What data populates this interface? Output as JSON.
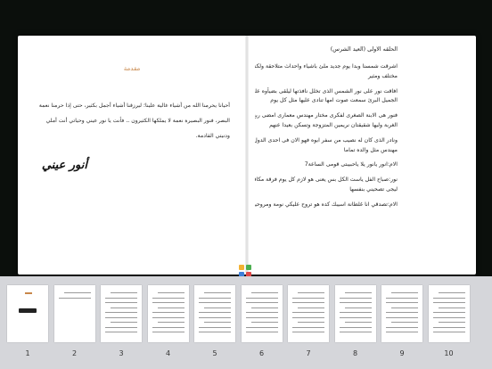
{
  "book": {
    "intro_title": "مقدمة",
    "intro_text": "أحيانا يحرمنا الله من أشياء غالية علينا؛ ليرزقنا أشياء أجمل بكثير، حتى إذا حرمنا نعمة البصر، فنور البصيرة نعمة لا يملكها الكثيرون .. فأنت يا نور عيني وحياتي أنت أملي ودنيتي القادمة.",
    "signature": "أنور عيني",
    "chapter_title": "الحلقه الاولى (العيد الشرس)",
    "chapter_lines": [
      "اشرقت شمسنا وبدا يوم جديد ملئ باشياء واحداث متلاحقة ولكنه عند نور يوم",
      "مختلف ومثير",
      "افاقت نور على نور الشمس الذى تخلل نافذتها ليلقى بضيأوه على وجهها",
      "الجميل البرئ سمعت صوت امها تنادى عليها مثل كل يوم",
      "فنور هى الابنة الصغرى لفكرى مختار مهندس معمارى امضى ربع عمره تقريبا فى",
      "الغربة وليها شقيقتان نريمين المتزوجة وتسكن بعيدا عنهم",
      "ونادر الذى كان له نصيب من سفر ابوه فهو الان فى احدى الدول العربية يعمل",
      "مهندس مثل والده تماما",
      "الام:انور يانور يلا ياحبيبتى قومى الساعة7",
      "نور:صباح الفل ياست الكل بس يعنى هو لازم كل يوم فرقة مكافحة المخدرات",
      "ليجى تصحيني بنفسها",
      "الام:تصدقي انا غلطانة اسيبك كده هو تروح عليكي نومة ومروحيش الكلية"
    ]
  },
  "loading_icon": "photos-icon",
  "loading_colors": [
    "#f2b233",
    "#4caf50",
    "#3d7fd9",
    "#e04848"
  ],
  "thumbnails": [
    {
      "number": "1"
    },
    {
      "number": "2"
    },
    {
      "number": "3"
    },
    {
      "number": "4"
    },
    {
      "number": "5"
    },
    {
      "number": "6"
    },
    {
      "number": "7"
    },
    {
      "number": "8"
    },
    {
      "number": "9"
    },
    {
      "number": "10"
    }
  ]
}
